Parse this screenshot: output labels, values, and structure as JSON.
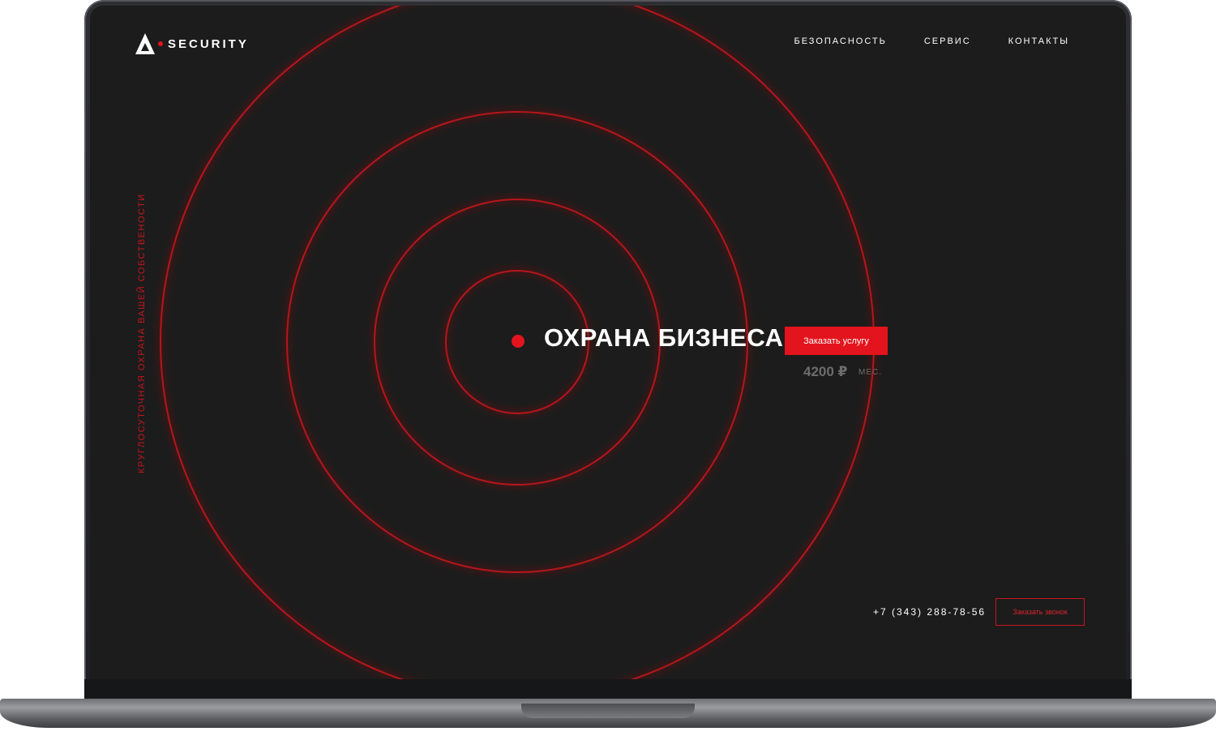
{
  "brand": {
    "name": "SECURITY",
    "accent": "#e3141d"
  },
  "nav": [
    {
      "label": "БЕЗОПАСНОСТЬ"
    },
    {
      "label": "СЕРВИС"
    },
    {
      "label": "КОНТАКТЫ"
    }
  ],
  "tagline": "КРУГЛОСУТОЧНАЯ ОХРАНА ВАШЕЙ СОБСТВЕНОСТИ",
  "hero": {
    "title": "ОХРАНА БИЗНЕСА",
    "order_button": "Заказать услугу",
    "price": "4200 ₽",
    "price_unit": "МЕС."
  },
  "contact": {
    "phone": "+7 (343) 288-78-56",
    "call_button": "Заказать звонок"
  }
}
